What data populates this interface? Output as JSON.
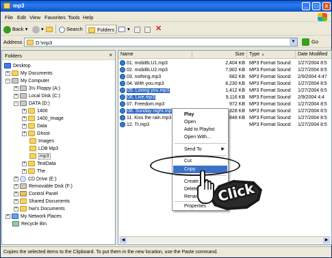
{
  "window": {
    "title": "mp3",
    "controls": [
      "_",
      "□",
      "x"
    ]
  },
  "menu": [
    "File",
    "Edit",
    "View",
    "Favorites",
    "Tools",
    "Help"
  ],
  "toolbar": {
    "back": "Back",
    "search": "Search",
    "folders": "Folders"
  },
  "address": {
    "label": "Address",
    "value": "D:\\mp3",
    "go": "Go"
  },
  "folders_pane": {
    "title": "Folders",
    "close": "×",
    "items": [
      {
        "label": "Desktop",
        "icon": "desktop-icon"
      },
      {
        "label": "My Documents",
        "icon": "folder-icon"
      },
      {
        "label": "My Computer",
        "icon": "computer-icon"
      },
      {
        "label": "3½ Floppy (A:)",
        "icon": "floppy-icon"
      },
      {
        "label": "Local Disk (C:)",
        "icon": "drive-icon"
      },
      {
        "label": "DATA (D:)",
        "icon": "drive-icon"
      },
      {
        "label": "1400",
        "icon": "folder-icon"
      },
      {
        "label": "1400_Image",
        "icon": "folder-icon"
      },
      {
        "label": "Data",
        "icon": "folder-icon"
      },
      {
        "label": "Ghost",
        "icon": "folder-icon"
      },
      {
        "label": "Images",
        "icon": "folder-icon"
      },
      {
        "label": "LDB Mp3",
        "icon": "folder-icon"
      },
      {
        "label": "mp3",
        "icon": "folder-icon"
      },
      {
        "label": "TestData",
        "icon": "folder-icon"
      },
      {
        "label": "The",
        "icon": "folder-icon"
      },
      {
        "label": "CD Drive (E:)",
        "icon": "cd-drive-icon"
      },
      {
        "label": "Removable Disk (F:)",
        "icon": "removable-disk-icon"
      },
      {
        "label": "Control Panel",
        "icon": "control-panel-icon"
      },
      {
        "label": "Shared Documents",
        "icon": "folder-icon"
      },
      {
        "label": "hwi's Documents",
        "icon": "folder-icon"
      },
      {
        "label": "My Network Places",
        "icon": "network-icon"
      },
      {
        "label": "Recycle Bin",
        "icon": "recycle-bin-icon"
      }
    ]
  },
  "columns": {
    "name": "Name",
    "size": "Size",
    "type": "Type",
    "date": "Date Modified"
  },
  "files": [
    {
      "name": "01. mobiBLU1.mp3",
      "size": "2,404 KB",
      "type": "MP3 Format Sound",
      "date": "1/27/2004 8:5",
      "selected": false
    },
    {
      "name": "02. mobiBLU2.mp3",
      "size": "7,902 KB",
      "type": "MP3 Format Sound",
      "date": "1/27/2004 8:5",
      "selected": false
    },
    {
      "name": "03. nothing.mp3",
      "size": "682 KB",
      "type": "MP3 Format Sound",
      "date": "2/9/2004 4:47",
      "selected": false
    },
    {
      "name": "04. With you.mp3",
      "size": "8,230 KB",
      "type": "MP3 Format Sound",
      "date": "1/27/2004 8:5",
      "selected": false
    },
    {
      "name": "05. Loving you.mp3",
      "size": "1,412 KB",
      "type": "MP3 Format Sound",
      "date": "1/27/2004 8:5",
      "selected": true
    },
    {
      "name": "06. Live.mp3",
      "size": "9,116 KB",
      "type": "MP3 Format Sound",
      "date": "2/9/2004 4:4",
      "selected": true
    },
    {
      "name": "07. Freedom.mp3",
      "size": "972 KB",
      "type": "MP3 Format Sound",
      "date": "1/27/2004 8:5",
      "selected": false
    },
    {
      "name": "08. Sunday night.mp3",
      "size": "328 KB",
      "type": "MP3 Format Sound",
      "date": "1/27/2004 8:5",
      "selected": true
    },
    {
      "name": "11. Kiss the rain.mp3",
      "size": "848 KB",
      "type": "MP3 Format Sound",
      "date": "1/27/2004 8:5",
      "selected": false
    },
    {
      "name": "12. Tr.mp3",
      "size": "",
      "type": "MP3 Format Sound",
      "date": "1/27/2004 8:5",
      "selected": false
    }
  ],
  "context_menu": {
    "play": "Play",
    "open": "Open",
    "add_to_playlist": "Add to Playlist",
    "open_with": "Open With...",
    "send_to": "Send To",
    "cut": "Cut",
    "copy": "Copy",
    "create_shortcut": "Create",
    "delete": "Delete",
    "rename": "Rename",
    "properties": "Properties"
  },
  "callout": {
    "text": "Click"
  },
  "status": {
    "text": "Copies the selected items to the Clipboard. To put them in the new location, use the Paste command."
  },
  "colors": {
    "selection": "#316ac5",
    "titlebar": "#0a5fd8",
    "window_bg": "#ece9d8"
  }
}
